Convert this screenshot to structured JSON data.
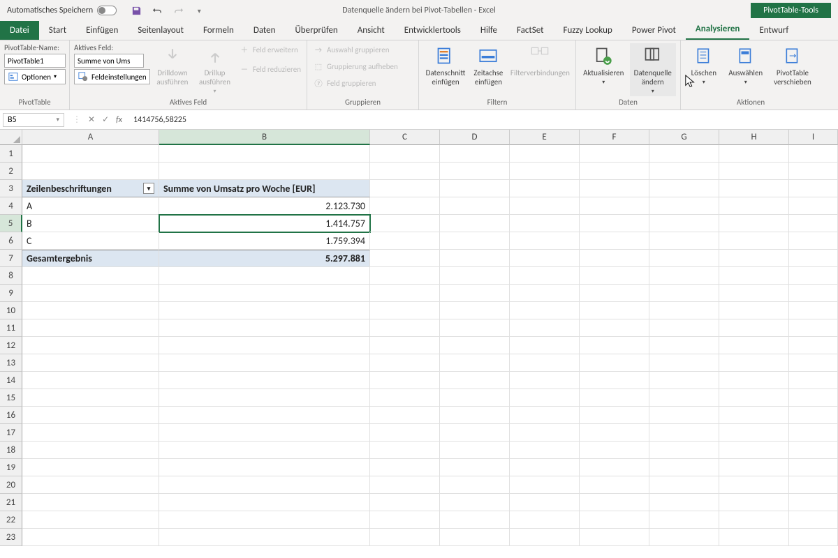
{
  "title_bar": {
    "autosave": "Automatisches Speichern",
    "doc_title": "Datenquelle ändern bei Pivot-Tabellen - Excel",
    "context_tab": "PivotTable-Tools"
  },
  "tabs": {
    "file": "Datei",
    "start": "Start",
    "einfugen": "Einfügen",
    "seitenlayout": "Seitenlayout",
    "formeln": "Formeln",
    "daten": "Daten",
    "uberprufen": "Überprüfen",
    "ansicht": "Ansicht",
    "entwicklertools": "Entwicklertools",
    "hilfe": "Hilfe",
    "factset": "FactSet",
    "fuzzy": "Fuzzy Lookup",
    "powerpivot": "Power Pivot",
    "analysieren": "Analysieren",
    "entwurf": "Entwurf"
  },
  "ribbon": {
    "pt_name_label": "PivotTable-Name:",
    "pt_name_value": "PivotTable1",
    "options_label": "Optionen",
    "pt_group": "PivotTable",
    "active_field_label": "Aktives Feld:",
    "active_field_value": "Summe von Ums",
    "field_settings": "Feldeinstellungen",
    "drilldown": "Drilldown ausführen",
    "drillup": "Drillup ausführen",
    "feld_erweitern": "Feld erweitern",
    "feld_reduzieren": "Feld reduzieren",
    "active_field_group": "Aktives Feld",
    "auswahl_gruppieren": "Auswahl gruppieren",
    "gruppierung_aufheben": "Gruppierung aufheben",
    "feld_gruppieren": "Feld gruppieren",
    "gruppieren_group": "Gruppieren",
    "datenschnitt": "Datenschnitt einfügen",
    "zeitachse": "Zeitachse einfügen",
    "filterverbindungen": "Filterverbindungen",
    "filtern_group": "Filtern",
    "aktualisieren": "Aktualisieren",
    "datenquelle": "Datenquelle ändern",
    "daten_group": "Daten",
    "loschen": "Löschen",
    "auswahlen": "Auswählen",
    "pivotverschieben": "PivotTable verschieben",
    "aktionen_group": "Aktionen"
  },
  "formula_bar": {
    "namebox": "B5",
    "formula": "1414756,58225"
  },
  "columns": [
    "A",
    "B",
    "C",
    "D",
    "E",
    "F",
    "G",
    "H",
    "I"
  ],
  "pivot": {
    "header_a": "Zeilenbeschriftungen",
    "header_b": "Summe von Umsatz pro Woche [EUR]",
    "rows": [
      {
        "label": "A",
        "value": "2.123.730"
      },
      {
        "label": "B",
        "value": "1.414.757"
      },
      {
        "label": "C",
        "value": "1.759.394"
      }
    ],
    "total_label": "Gesamtergebnis",
    "total_value": "5.297.881"
  }
}
